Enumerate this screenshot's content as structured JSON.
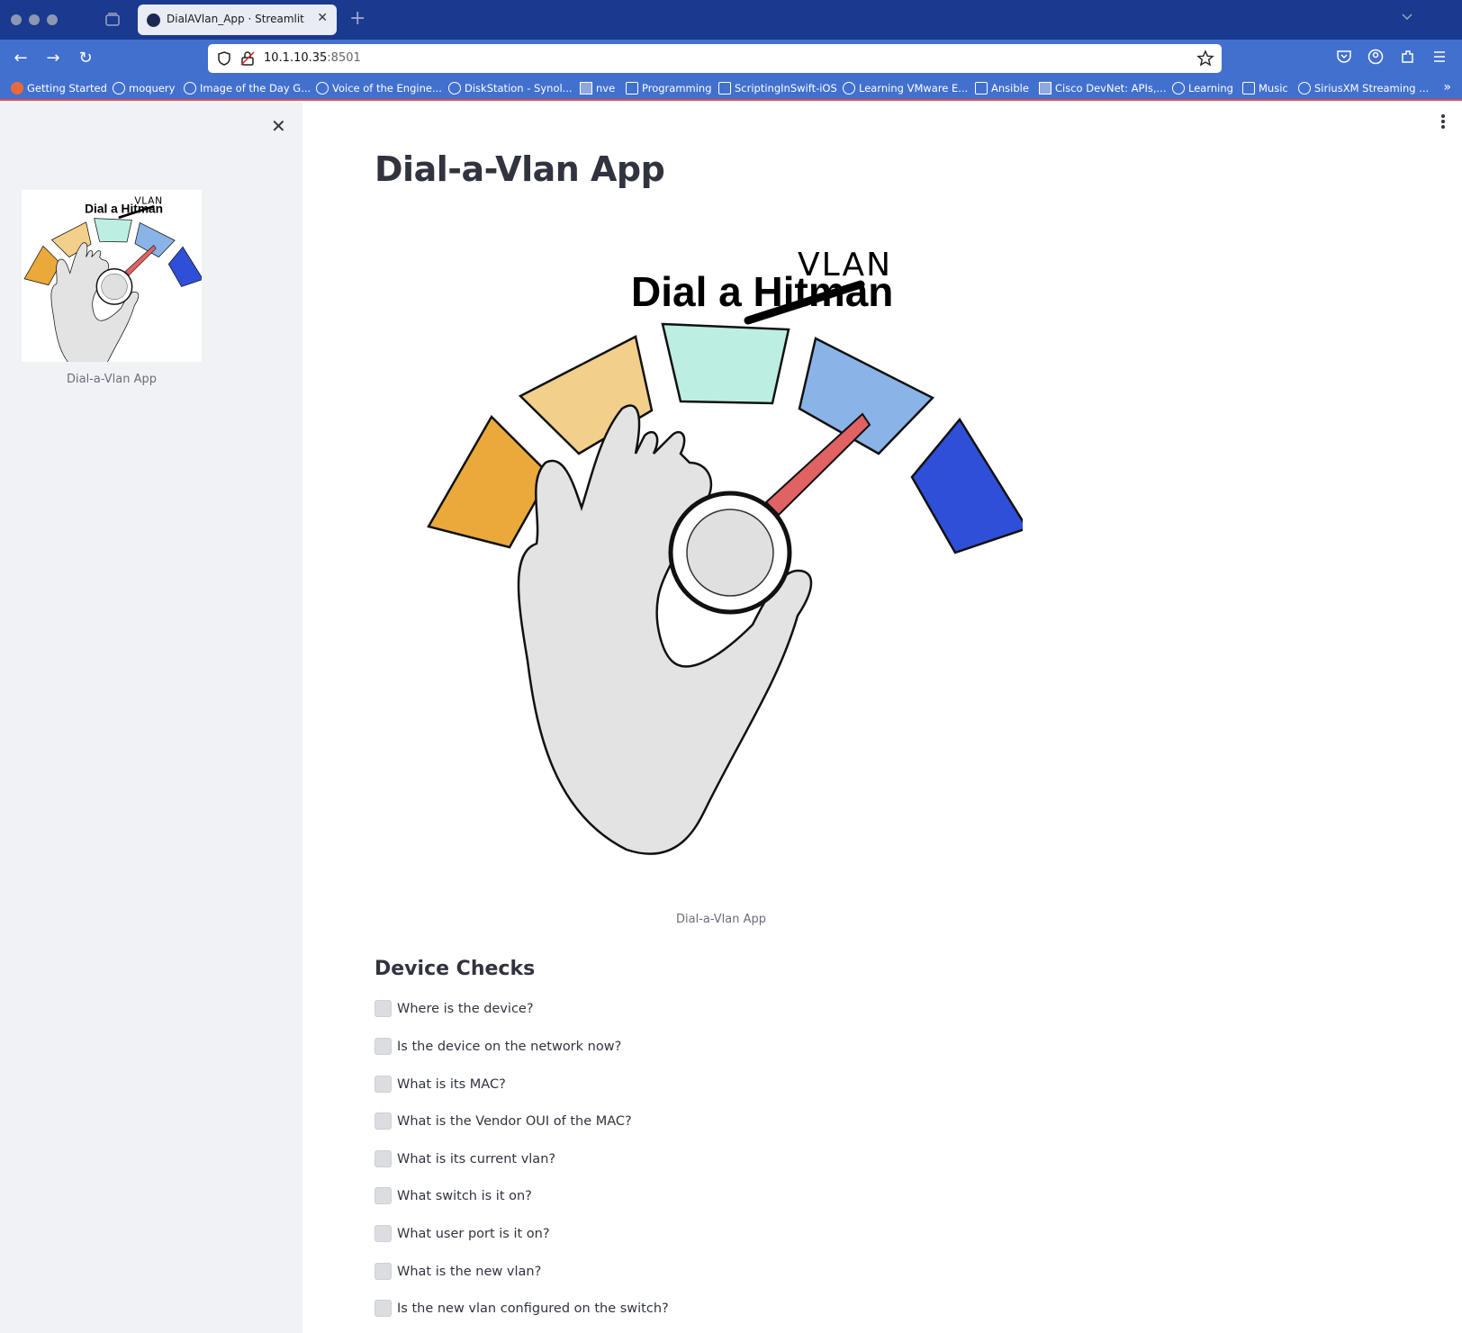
{
  "browser": {
    "tab_title": "DialAVlan_App · Streamlit",
    "url_host": "10.1.10.35",
    "url_port": ":8501",
    "bookmarks": [
      {
        "label": "Getting Started",
        "icon": "firefox-icon"
      },
      {
        "label": "moquery",
        "icon": "globe-icon"
      },
      {
        "label": "Image of the Day G...",
        "icon": "globe-icon"
      },
      {
        "label": "Voice of the Engine...",
        "icon": "globe-icon"
      },
      {
        "label": "DiskStation - Synol...",
        "icon": "globe-icon"
      },
      {
        "label": "nve",
        "icon": "site-icon"
      },
      {
        "label": "Programming",
        "icon": "folder-icon"
      },
      {
        "label": "ScriptingInSwift-iOS",
        "icon": "folder-icon"
      },
      {
        "label": "Learning VMware E...",
        "icon": "globe-icon"
      },
      {
        "label": "Ansible",
        "icon": "folder-icon"
      },
      {
        "label": "Cisco DevNet: APIs,...",
        "icon": "site-icon"
      },
      {
        "label": "Learning",
        "icon": "globe-icon"
      },
      {
        "label": "Music",
        "icon": "folder-icon"
      },
      {
        "label": "SiriusXM Streaming ...",
        "icon": "globe-icon"
      }
    ],
    "colors": {
      "tabbar": "#1a3a8f",
      "navbar": "#4270ce"
    }
  },
  "sidebar": {
    "image_caption": "Dial-a-Vlan App"
  },
  "main": {
    "title": "Dial-a-Vlan App",
    "hero_caption": "Dial-a-Vlan App",
    "logo_text": {
      "line": "Dial a Hitman",
      "overwrite": "VLAN"
    },
    "section_title": "Device Checks",
    "checks": [
      "Where is the device?",
      "Is the device on the network now?",
      "What is its MAC?",
      "What is the Vendor OUI of the MAC?",
      "What is its current vlan?",
      "What switch is it on?",
      "What user port is it on?",
      "What is the new vlan?",
      "Is the new vlan configured on the switch?"
    ]
  }
}
